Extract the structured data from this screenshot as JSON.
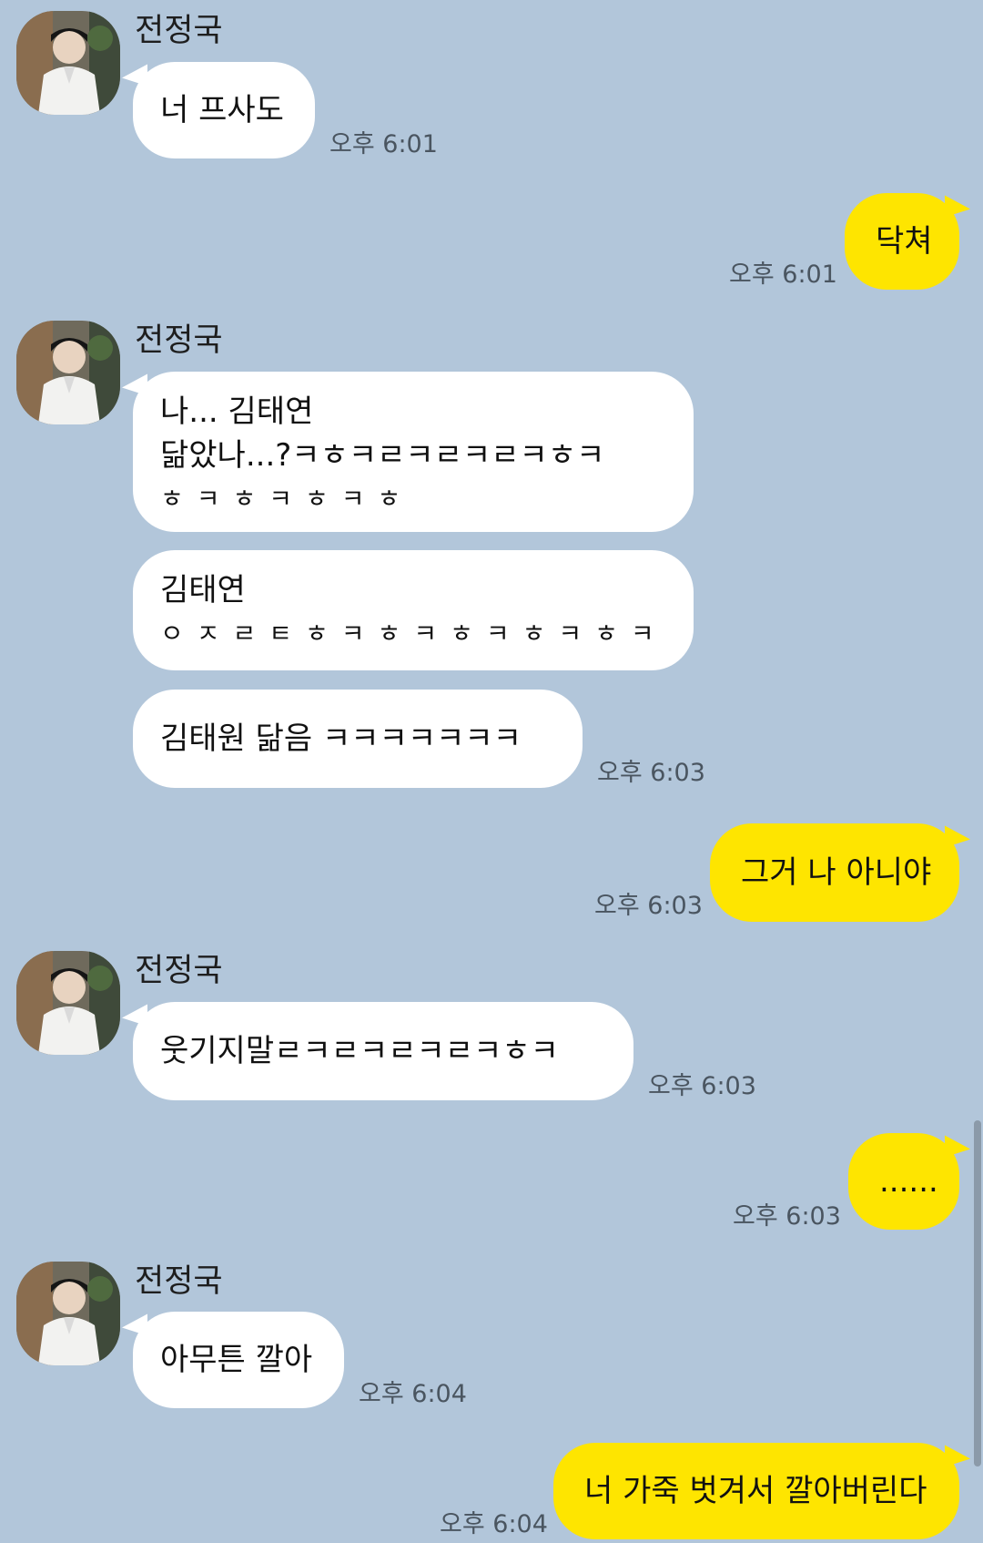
{
  "contact": {
    "name": "전정국"
  },
  "messages": [
    {
      "sender": "전정국",
      "lines": [
        "너 프사도"
      ],
      "time": "오후 6:01"
    },
    {
      "sender": "me",
      "lines": [
        "닥쳐"
      ],
      "time": "오후 6:01"
    },
    {
      "sender": "전정국",
      "lines": [
        "나... 김태연",
        "닮았나...?ㅋㅎㅋㄹㅋㄹㅋㄹㅋㅎㅋ",
        "ㅎㅋㅎㅋㅎㅋㅎ"
      ]
    },
    {
      "sender": "전정국",
      "lines": [
        "김태연",
        "ㅇㅈㄹㅌㅎㅋㅎㅋㅎㅋㅎㅋㅎㅋ"
      ]
    },
    {
      "sender": "전정국",
      "lines": [
        "김태원 닮음 ㅋㅋㅋㅋㅋㅋㅋ"
      ],
      "time": "오후 6:03"
    },
    {
      "sender": "me",
      "lines": [
        "그거 나 아니야"
      ],
      "time": "오후 6:03"
    },
    {
      "sender": "전정국",
      "lines": [
        "웃기지말ㄹㅋㄹㅋㄹㅋㄹㅋㅎㅋ"
      ],
      "time": "오후 6:03"
    },
    {
      "sender": "me",
      "lines": [
        "......"
      ],
      "time": "오후 6:03"
    },
    {
      "sender": "전정국",
      "lines": [
        "아무튼 깔아"
      ],
      "time": "오후 6:04"
    },
    {
      "sender": "me",
      "lines": [
        "너 가죽 벗겨서 깔아버린다"
      ],
      "time": "오후 6:04"
    }
  ],
  "colors": {
    "background": "#b2c6da",
    "incoming_bubble": "#ffffff",
    "outgoing_bubble": "#fee500",
    "timestamp": "#4a5560"
  },
  "icons": {
    "avatar": "profile-photo-avatar"
  }
}
